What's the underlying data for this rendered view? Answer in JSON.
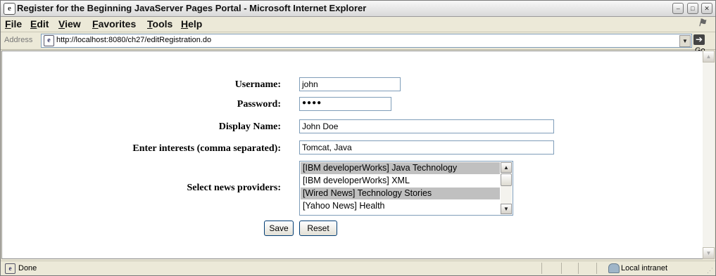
{
  "window": {
    "title": "Register for the Beginning JavaServer Pages Portal - Microsoft Internet Explorer",
    "ie_icon": "ie-page-icon"
  },
  "menu": [
    "File",
    "Edit",
    "View",
    "Favorites",
    "Tools",
    "Help"
  ],
  "address": {
    "label": "Address",
    "url": "http://localhost:8080/ch27/editRegistration.do",
    "go_label": "Go"
  },
  "form": {
    "username_label": "Username:",
    "username_value": "john",
    "password_label": "Password:",
    "password_value": "●●●●",
    "display_name_label": "Display Name:",
    "display_name_value": "John Doe",
    "interests_label": "Enter interests (comma separated):",
    "interests_value": "Tomcat, Java",
    "news_label": "Select news providers:",
    "news_options": [
      {
        "label": "[IBM developerWorks] Java Technology",
        "selected": true
      },
      {
        "label": "[IBM developerWorks] XML",
        "selected": false
      },
      {
        "label": "[Wired News] Technology Stories",
        "selected": true
      },
      {
        "label": "[Yahoo News] Health",
        "selected": false
      }
    ],
    "save_label": "Save",
    "reset_label": "Reset"
  },
  "status": {
    "text": "Done",
    "zone": "Local intranet"
  }
}
